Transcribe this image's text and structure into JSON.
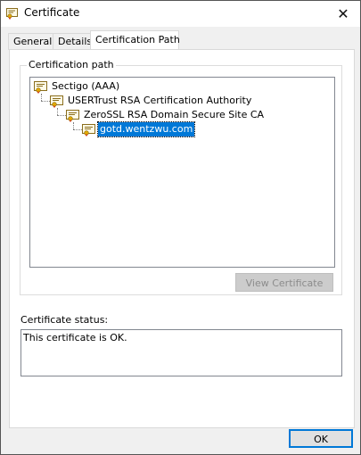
{
  "window": {
    "title": "Certificate",
    "close_glyph": "✕"
  },
  "tabs": [
    {
      "label": "General",
      "active": false
    },
    {
      "label": "Details",
      "active": false
    },
    {
      "label": "Certification Path",
      "active": true
    }
  ],
  "certification_path": {
    "group_label": "Certification path",
    "nodes": [
      {
        "label": "Sectigo (AAA)",
        "icon": "certificate-icon",
        "selected": false
      },
      {
        "label": "USERTrust RSA Certification Authority",
        "icon": "certificate-icon",
        "selected": false
      },
      {
        "label": "ZeroSSL RSA Domain Secure Site CA",
        "icon": "certificate-icon",
        "selected": false
      },
      {
        "label": "gotd.wentzwu.com",
        "icon": "certificate-icon",
        "selected": true
      }
    ],
    "view_button_label": "View Certificate",
    "view_button_enabled": false
  },
  "status": {
    "label": "Certificate status:",
    "text": "This certificate is OK."
  },
  "footer": {
    "ok_label": "OK"
  },
  "colors": {
    "selection": "#0078d7",
    "default_button_border": "#0078d7",
    "dialog_background": "#f0f0f0"
  }
}
